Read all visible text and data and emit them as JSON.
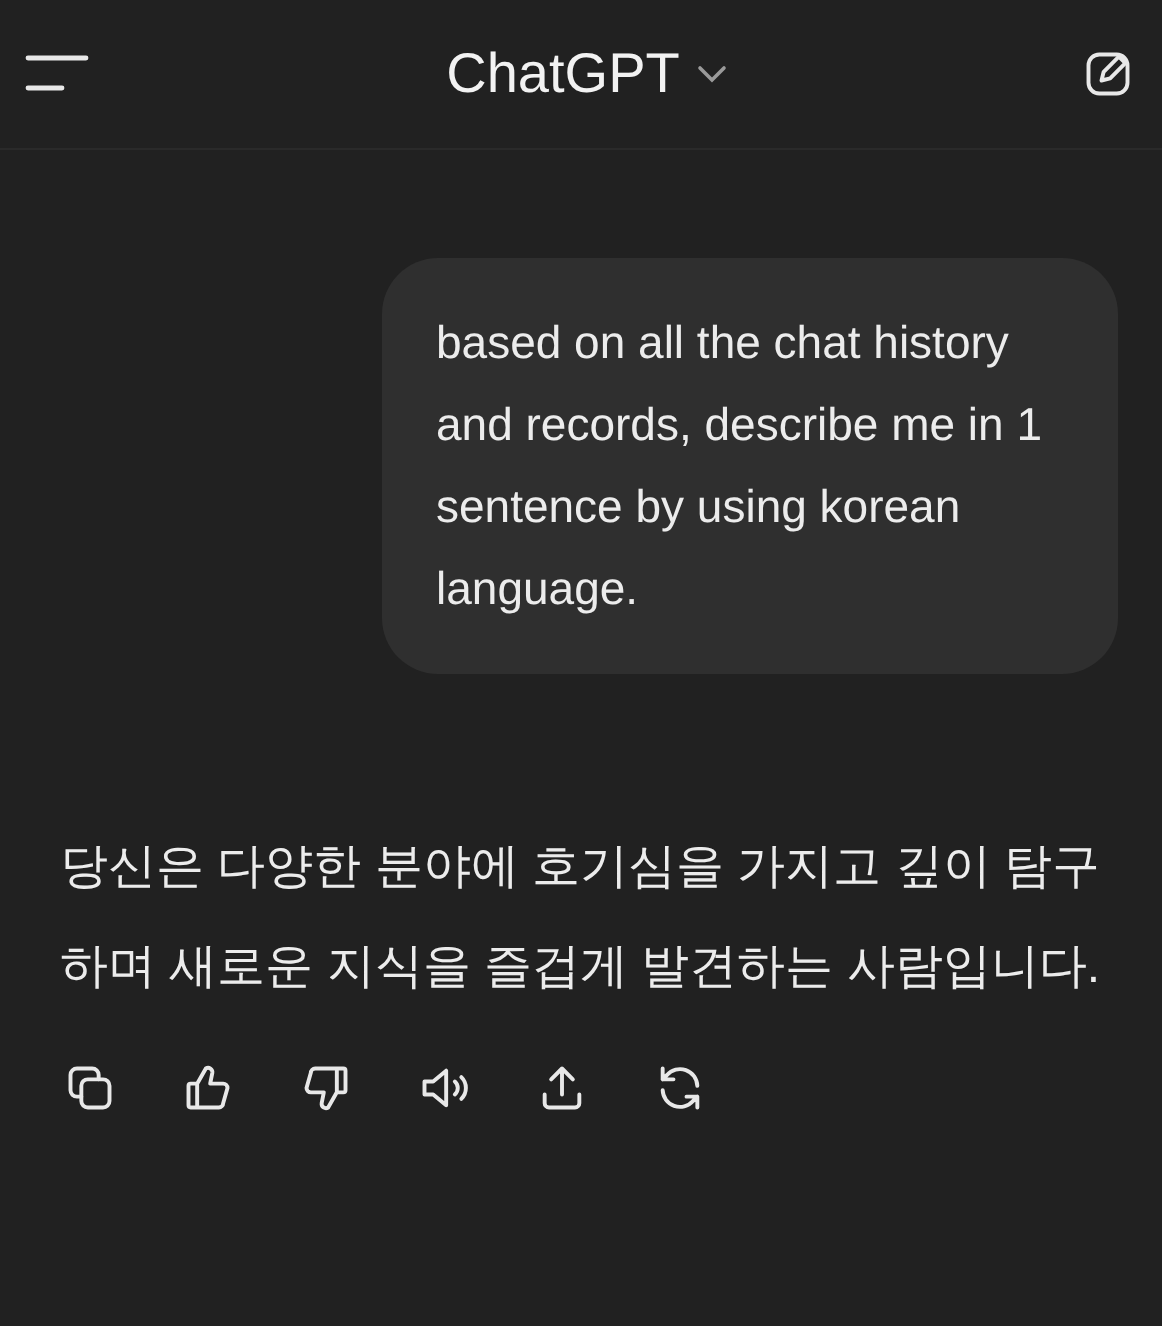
{
  "header": {
    "title": "ChatGPT"
  },
  "messages": [
    {
      "kind": "user",
      "text": "based on all the chat history and records, describe me in 1 sentence by using korean language."
    },
    {
      "kind": "assistant",
      "text": "당신은 다양한 분야에 호기심을 가지고 깊이 탐구하며 새로운 지식을 즐겁게 발견하는 사람입니다."
    }
  ]
}
